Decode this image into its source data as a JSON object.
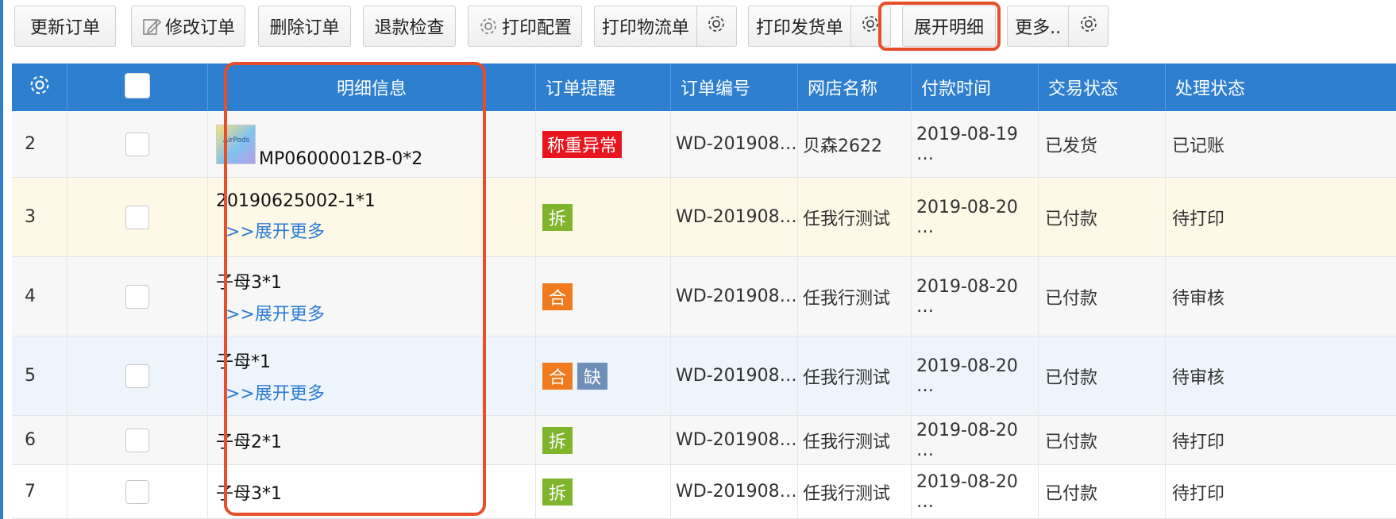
{
  "toolbar": {
    "update_order": "更新订单",
    "modify_order": "修改订单",
    "delete_order": "删除订单",
    "refund_check": "退款检查",
    "print_config": "打印配置",
    "print_logistics": "打印物流单",
    "print_delivery": "打印发货单",
    "expand_detail": "展开明细",
    "more": "更多.."
  },
  "columns": {
    "detail_info": "明细信息",
    "order_remind": "订单提醒",
    "order_no": "订单编号",
    "shop_name": "网店名称",
    "pay_time": "付款时间",
    "trade_status": "交易状态",
    "process_status": "处理状态"
  },
  "rows": [
    {
      "num": "2",
      "detail": "MP06000012B-0*2",
      "more": "",
      "tags": [
        "称重异常"
      ],
      "order_no": "WD-201908…",
      "shop": "贝森2622",
      "pay_time": "2019-08-19 …",
      "trade": "已发货",
      "process": "已记账"
    },
    {
      "num": "3",
      "detail": "20190625002-1*1",
      "more": ">>展开更多",
      "tags": [
        "拆"
      ],
      "order_no": "WD-201908…",
      "shop": "任我行测试",
      "pay_time": "2019-08-20 …",
      "trade": "已付款",
      "process": "待打印"
    },
    {
      "num": "4",
      "detail": "子母3*1",
      "more": ">>展开更多",
      "tags": [
        "合"
      ],
      "order_no": "WD-201908…",
      "shop": "任我行测试",
      "pay_time": "2019-08-20 …",
      "trade": "已付款",
      "process": "待审核"
    },
    {
      "num": "5",
      "detail": "子母*1",
      "more": ">>展开更多",
      "tags": [
        "合",
        "缺"
      ],
      "order_no": "WD-201908…",
      "shop": "任我行测试",
      "pay_time": "2019-08-20 …",
      "trade": "已付款",
      "process": "待审核"
    },
    {
      "num": "6",
      "detail": "子母2*1",
      "more": "",
      "tags": [
        "拆"
      ],
      "order_no": "WD-201908…",
      "shop": "任我行测试",
      "pay_time": "2019-08-20 …",
      "trade": "已付款",
      "process": "待打印"
    },
    {
      "num": "7",
      "detail": "子母3*1",
      "more": "",
      "tags": [
        "拆"
      ],
      "order_no": "WD-201908…",
      "shop": "任我行测试",
      "pay_time": "2019-08-20 …",
      "trade": "已付款",
      "process": "待打印"
    }
  ],
  "thumb_text": "AirPods",
  "colors": {
    "header": "#2e7fcf",
    "highlight": "#e84e2c",
    "tag_red": "#e8141e",
    "tag_green": "#7fb42d",
    "tag_orange": "#f07a1e",
    "tag_gray": "#6e8fb7",
    "link": "#2a7bd4"
  },
  "icons": [
    "gear-icon",
    "edit-icon"
  ]
}
